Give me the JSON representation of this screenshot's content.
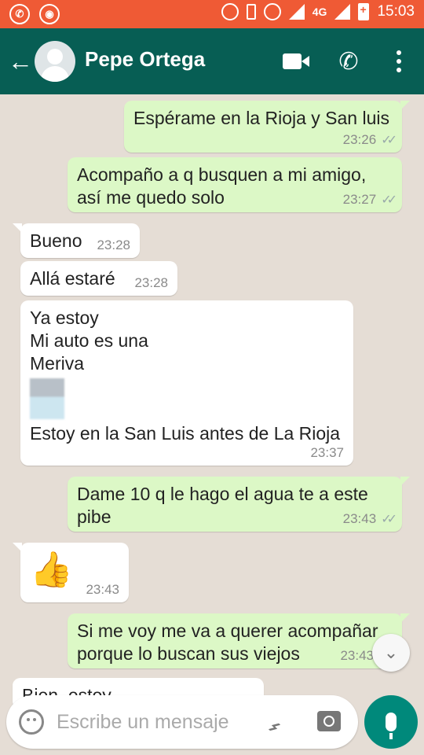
{
  "status_bar": {
    "network": "4G",
    "time": "15:03"
  },
  "header": {
    "contact_name": "Pepe Ortega"
  },
  "messages": [
    {
      "dir": "out",
      "text": "Espérame en la Rioja y San luis",
      "time": "23:26"
    },
    {
      "dir": "out",
      "text": "Acompaño a q busquen a mi amigo,\nasí me quedo solo",
      "time": "23:27"
    },
    {
      "dir": "in",
      "text": "Bueno",
      "time": "23:28"
    },
    {
      "dir": "in",
      "text": "Allá estaré",
      "time": "23:28"
    },
    {
      "dir": "in",
      "text_top": "Ya estoy\nMi auto es una\nMeriva",
      "text_bottom": "Estoy en la San Luis antes de La Rioja",
      "time": "23:37"
    },
    {
      "dir": "out",
      "text": "Dame 10 q le hago el agua te a este\npibe",
      "time": "23:43"
    },
    {
      "dir": "in",
      "emoji": "👍",
      "time": "23:43"
    },
    {
      "dir": "out",
      "text": "Si me voy me va a querer acompañar\nporque lo buscan sus viejos",
      "time": "23:43"
    },
    {
      "dir": "in",
      "text": "Bien, estoy...",
      "time": ""
    }
  ],
  "composer": {
    "placeholder": "Escribe un mensaje"
  },
  "colors": {
    "header": "#075e54",
    "status_bar": "#ef5a35",
    "outgoing": "#dcf8c6",
    "incoming": "#ffffff",
    "background": "#e5ddd5",
    "mic": "#00897b"
  },
  "icons": [
    "whatsapp-icon",
    "chrome-icon",
    "back-arrow-icon",
    "video-call-icon",
    "phone-icon",
    "menu-icon",
    "scroll-down-icon",
    "emoji-icon",
    "attach-icon",
    "camera-icon",
    "mic-icon"
  ]
}
